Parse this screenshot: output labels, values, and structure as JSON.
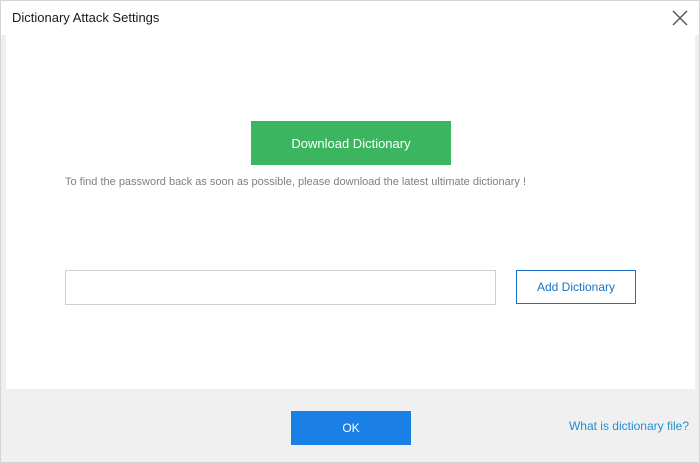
{
  "window": {
    "title": "Dictionary Attack Settings",
    "close_icon": "close-icon"
  },
  "main": {
    "download_label": "Download Dictionary",
    "hint": "To find the password back as soon as possible, please download the latest ultimate dictionary !",
    "dictionary_path": {
      "value": "",
      "placeholder": ""
    },
    "add_label": "Add Dictionary"
  },
  "footer": {
    "ok_label": "OK",
    "help_link": "What is dictionary file?"
  },
  "colors": {
    "download_button": "#3bb55f",
    "ok_button": "#1a80e6",
    "accent_border": "#1a73c7",
    "link": "#1f8fd6"
  }
}
